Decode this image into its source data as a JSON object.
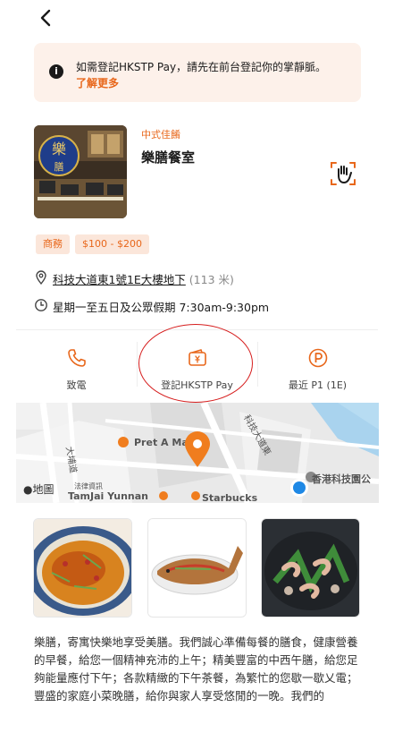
{
  "header": {
    "back_icon": "chevron-left-icon"
  },
  "notice": {
    "message": "如需登記HKSTP Pay，請先在前台登記你的掌靜脈。",
    "link": "了解更多",
    "icon": "info-icon"
  },
  "restaurant": {
    "category": "中式佳餚",
    "name": "樂膳餐室",
    "palm_icon": "palm-scan-icon",
    "tags": [
      "商務",
      "$100 - $200"
    ],
    "address": "科技大道東1號1E大樓地下",
    "distance": "(113 米)",
    "hours": "星期一至五日及公眾假期 7:30am-9:30pm"
  },
  "actions": [
    {
      "label": "致電",
      "icon": "phone-icon"
    },
    {
      "label": "登記HKSTP Pay",
      "icon": "wallet-icon"
    },
    {
      "label": "最近 P1 (1E)",
      "icon": "parking-icon"
    }
  ],
  "map": {
    "pois": [
      "Pret A Ma",
      "TamJai Yunnan",
      "Starbucks",
      "香港科技園公"
    ],
    "streets": [
      "科技大道東",
      "大埔道",
      "法律資訊"
    ],
    "attribution": "地圖",
    "colors": {
      "pin": "#f07d1e",
      "location": "#1e88e5"
    }
  },
  "photos": [
    "dish-1",
    "dish-2",
    "dish-3"
  ],
  "description": "樂膳，寄寓快樂地享受美膳。我們誠心準備每餐的膳食，健康營養的早餐，給您一個精神充沛的上午；精美豐富的中西午膳，給您足夠能量應付下午；各款精緻的下午茶餐，為繁忙的您歇一歇乂電；豐盛的家庭小菜晚膳，給你與家人享受悠閒的一晚。我們的",
  "colors": {
    "accent": "#e8671b",
    "tag_bg": "#fbe6da",
    "notice_bg": "#fdf1ea"
  }
}
